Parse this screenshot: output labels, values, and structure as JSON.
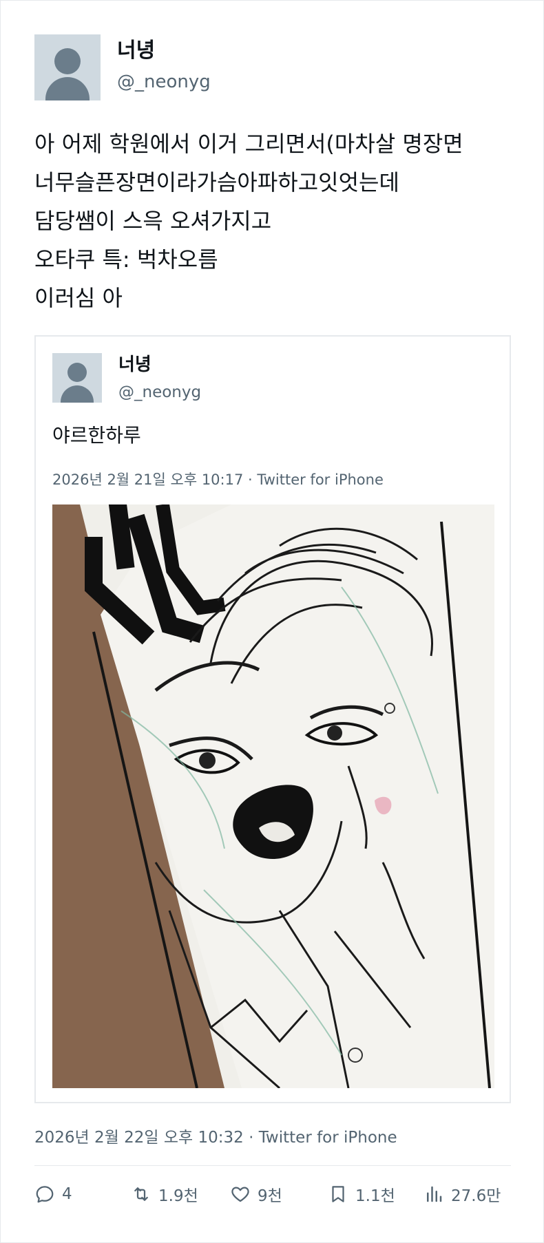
{
  "tweet": {
    "author": {
      "display_name": "너녕",
      "handle": "@_neonyg"
    },
    "lines": [
      "아 어제 학원에서 이거 그리면서(마차살 명장면",
      "너무슬픈장면이라가슴아파하고잇엇는데",
      "담당쌤이 스윽 오셔가지고",
      "오타쿠 특: 벅차오름",
      "이러심 아"
    ],
    "timestamp": "2026년 2월 22일 오후 10:32 · Twitter for iPhone"
  },
  "quote": {
    "author": {
      "display_name": "너녕",
      "handle": "@_neonyg"
    },
    "text": "야르한하루",
    "timestamp": "2026년 2월 21일 오후 10:17 · Twitter for iPhone",
    "image": {
      "subject": "manga-sketch-crying-boy",
      "mark": "ㅂ"
    }
  },
  "actions": {
    "replies": "4",
    "retweets": "1.9천",
    "likes": "9천",
    "bookmarks": "1.1천",
    "views": "27.6만"
  },
  "icons": {
    "reply": "reply-icon",
    "retweet": "retweet-icon",
    "like": "heart-icon",
    "bookmark": "bookmark-icon",
    "views": "views-icon"
  },
  "colors": {
    "secondary_text": "#536471",
    "border": "#e6e9ec",
    "avatar_bg": "#cfd9e0"
  }
}
